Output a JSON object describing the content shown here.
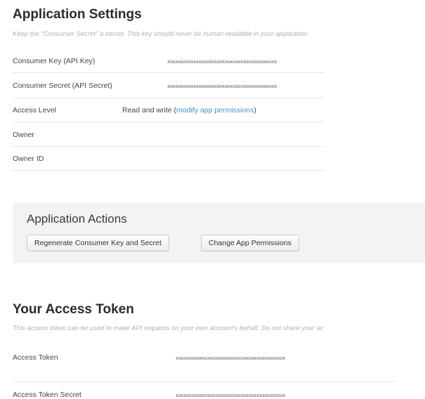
{
  "app_settings": {
    "title": "Application Settings",
    "hint": "Keep the \"Consumer Secret\" a secret. This key should never be human-readable in your application.",
    "rows": [
      {
        "label": "Consumer Key (API Key)",
        "value": "xxxxxxxxxxxxxxxxxxxxxxxxxxxxxxxxxxxxxxxxxx"
      },
      {
        "label": "Consumer Secret (API Secret)",
        "value": "xxxxxxxxxxxxxxxxxxxxxxxxxxxxxxxxxxxxxxxxxx"
      },
      {
        "label": "Access Level",
        "value": "Read and write (",
        "link": "modify app permissions",
        "suffix": ")"
      },
      {
        "label": "Owner",
        "value": ""
      },
      {
        "label": "Owner ID",
        "value": ""
      }
    ]
  },
  "app_actions": {
    "title": "Application Actions",
    "regenerate_label": "Regenerate Consumer Key and Secret",
    "change_permissions_label": "Change App Permissions"
  },
  "access_token": {
    "title": "Your Access Token",
    "hint": "This access token can be used to make API requests on your own account's behalf. Do not share your ac",
    "rows": [
      {
        "label": "Access Token",
        "value": "xxxxxxxxxxxxxxxxxxxxxxxxxxxxxxxxxxxxxxxxxx"
      },
      {
        "label": "Access Token Secret",
        "value": "xxxxxxxxxxxxxxxxxxxxxxxxxxxxxxxxxxxxxxxxxx"
      }
    ]
  }
}
